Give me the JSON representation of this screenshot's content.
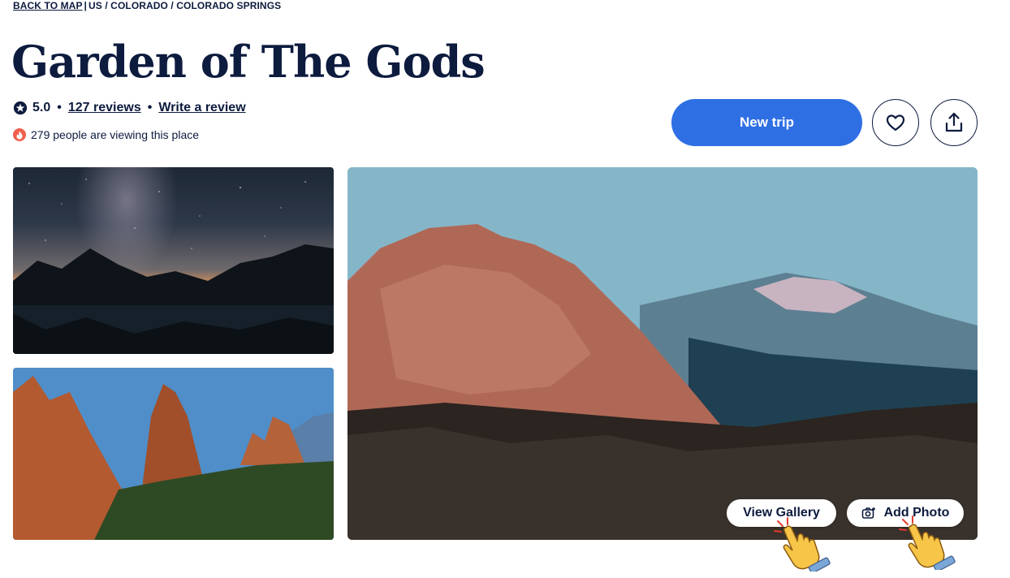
{
  "breadcrumb": {
    "back_label": "BACK TO MAP",
    "separator": "|",
    "path": "US / COLORADO / COLORADO SPRINGS"
  },
  "place": {
    "title": "Garden of The Gods",
    "rating": "5.0",
    "reviews_link": "127 reviews",
    "write_review_link": "Write a review",
    "dot": "•",
    "viewing_text": "279 people are viewing this place"
  },
  "actions": {
    "new_trip_label": "New trip",
    "favorite_icon": "heart-icon",
    "share_icon": "share-icon"
  },
  "gallery": {
    "view_gallery_label": "View Gallery",
    "add_photo_label": "Add Photo"
  },
  "colors": {
    "primary": "#2f6fe4",
    "text": "#0d1b3e",
    "fire": "#f0604d"
  }
}
